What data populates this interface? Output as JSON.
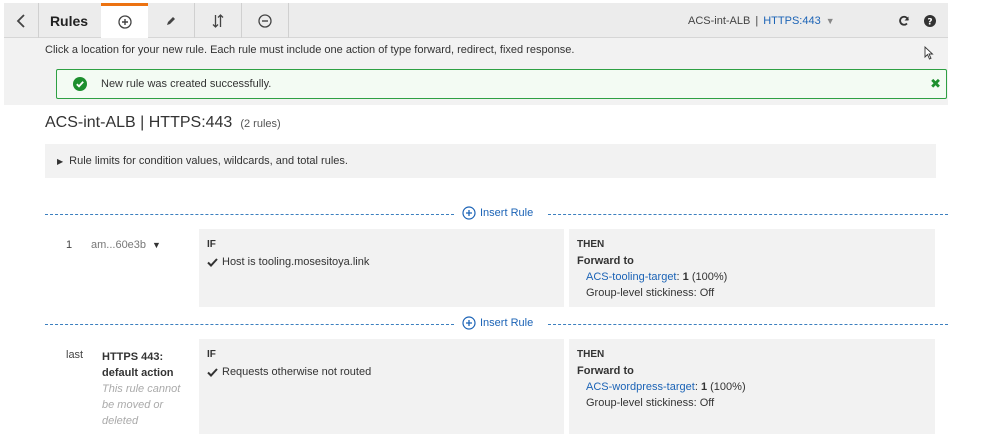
{
  "toolbar": {
    "title": "Rules",
    "load_balancer": "ACS-int-ALB",
    "separator": "|",
    "listener": "HTTPS:443",
    "icons": [
      "back-icon",
      "add-icon",
      "edit-icon",
      "reorder-icon",
      "remove-icon",
      "refresh-icon",
      "help-icon"
    ]
  },
  "instruction": "Click a location for your new rule. Each rule must include one action of type forward, redirect, fixed response.",
  "alert": {
    "message": "New rule was created successfully.",
    "close": "✖",
    "color": "#2ea043"
  },
  "heading": {
    "title": "ACS-int-ALB | HTTPS:443",
    "count": "(2 rules)"
  },
  "limits": {
    "text": "Rule limits for condition values, wildcards, and total rules."
  },
  "insert_label": "Insert Rule",
  "rules": [
    {
      "number": "1",
      "name": "am...60e3b",
      "if_label": "IF",
      "condition": "Host is tooling.mosesitoya.link",
      "then_label": "THEN",
      "action": "Forward to",
      "target": "ACS-tooling-target",
      "weight_sep": ":",
      "weight": "1",
      "percent": "(100%)",
      "stickiness": "Group-level stickiness: Off"
    },
    {
      "number": "last",
      "name_line1": "HTTPS 443:",
      "name_line2": "default action",
      "note": "This rule cannot be moved or deleted",
      "if_label": "IF",
      "condition": "Requests otherwise not routed",
      "then_label": "THEN",
      "action": "Forward to",
      "target": "ACS-wordpress-target",
      "weight_sep": ":",
      "weight": "1",
      "percent": "(100%)",
      "stickiness": "Group-level stickiness: Off"
    }
  ],
  "colors": {
    "accent_tab": "#ec7211",
    "link": "#1b63b6",
    "success": "#2ea043"
  }
}
